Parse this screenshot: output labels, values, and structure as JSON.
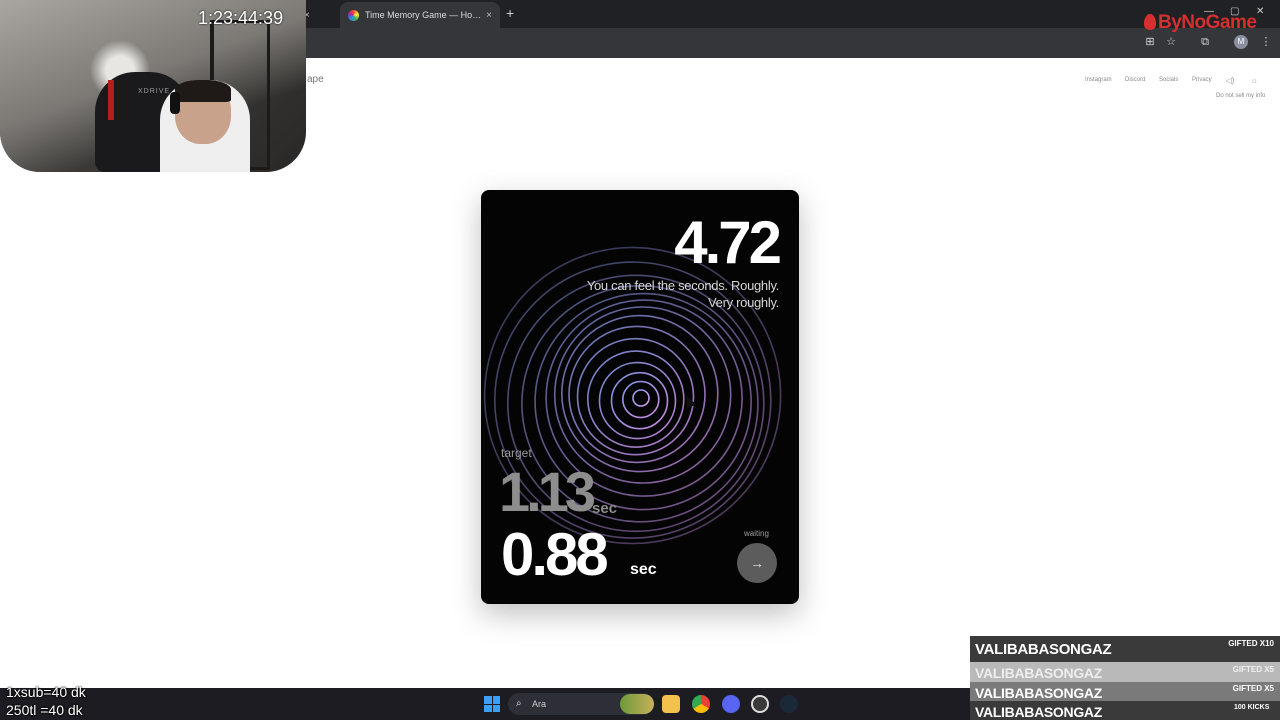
{
  "browser": {
    "tabs": [
      {
        "label": "",
        "active": false
      },
      {
        "label": "Time Memory Game — How Good Is Your Internal Clock",
        "active": true
      }
    ],
    "new_tab_label": "+",
    "close_glyph": "×"
  },
  "stream": {
    "timer": "1:23:44:39",
    "logo_text": "ByNoGame",
    "chair_text": "XDRIVE",
    "sub_note_1": "1xsub=40 dk",
    "sub_note_2": "250tl =40 dk",
    "gifts": [
      {
        "name": "VALIBABASONGAZ",
        "tag": "GIFTED X10"
      },
      {
        "name": "VALIBABASONGAZ",
        "tag": "GIFTED X5"
      },
      {
        "name": "VALIBABASONGAZ",
        "tag": "GIFTED X5"
      },
      {
        "name": "VALIBABASONGAZ",
        "tag": ""
      }
    ],
    "kicks": "100 KICKS"
  },
  "site": {
    "brand_fragment": "ape",
    "nav": [
      "Instagram",
      "Discord",
      "Socials",
      "Privacy"
    ],
    "do_not_sell": "Do not sell my info"
  },
  "game": {
    "score": "4.72",
    "message_line1": "You can feel the seconds. Roughly.",
    "message_line2": "Very roughly.",
    "target_label": "target",
    "target_value": "1.13",
    "target_unit": "sec",
    "result_value": "0.88",
    "result_unit": "sec",
    "status": "waiting",
    "next_glyph": "→"
  },
  "taskbar": {
    "search_placeholder": "Ara"
  },
  "icons": {
    "search": "search-icon",
    "next": "arrow-right-icon"
  },
  "colors": {
    "card_bg": "#040404",
    "ring_blue": "#8fa8ff",
    "ring_pink": "#e89cff",
    "logo_red": "#d62f2f"
  }
}
